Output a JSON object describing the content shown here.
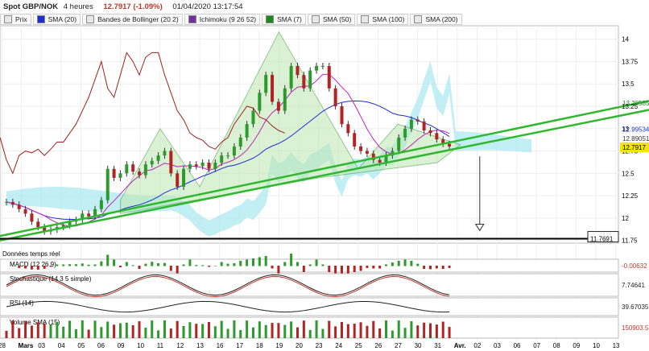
{
  "header": {
    "instrument": "Spot GBP/NOK",
    "timeframe": "4 heures",
    "price_change": "12.7917 (-1.09%)",
    "datetime": "01/04/2020 13:17:54"
  },
  "legend": [
    {
      "label": "Prix",
      "color": "#e8e8e8"
    },
    {
      "label": "SMA (20)",
      "color": "#1a2fd8"
    },
    {
      "label": "Bandes de Bollinger (20 2)",
      "color": "#e8e8e8"
    },
    {
      "label": "Ichimoku (9 26 52)",
      "color": "#7030a0"
    },
    {
      "label": "SMA (7)",
      "color": "#1a8a1a"
    },
    {
      "label": "SMA (50)",
      "color": "#e8e8e8"
    },
    {
      "label": "SMA (100)",
      "color": "#e8e8e8"
    },
    {
      "label": "SMA (200)",
      "color": "#e8e8e8"
    }
  ],
  "panels": {
    "volume_source": "Données temps réel",
    "macd": {
      "label": "MACD (12 26 9)",
      "value": "-0.00632"
    },
    "stoch": {
      "label": "Stochastique (14 3 5 simple)",
      "value": "7.74641"
    },
    "rsi": {
      "label": "RSI (14)",
      "value": "39.67035"
    },
    "volume": {
      "label": "Volume",
      "sma_label": "SMA (15)",
      "value": "150903.53"
    }
  },
  "chart_data": {
    "type": "candlestick",
    "ylim": [
      11.72,
      14.15
    ],
    "y_ticks": [
      "14",
      "13.75",
      "13.5",
      "13.25",
      "13",
      "12.75",
      "12.5",
      "12.25",
      "12",
      "11.75"
    ],
    "x_ticks": [
      "28",
      "Mars",
      "03",
      "04",
      "05",
      "06",
      "09",
      "10",
      "11",
      "12",
      "13",
      "16",
      "17",
      "18",
      "19",
      "20",
      "23",
      "24",
      "25",
      "26",
      "27",
      "30",
      "31",
      "Avr.",
      "02",
      "03",
      "06",
      "07",
      "08",
      "09",
      "10",
      "13"
    ],
    "price_labels": [
      {
        "text": "13.28585",
        "value": 13.286,
        "color": "#1a8a1a"
      },
      {
        "text": "12.99534",
        "value": 12.995,
        "color": "#1a2fd8"
      },
      {
        "text": "12.89051",
        "value": 12.891,
        "color": "#333333"
      },
      {
        "text": "12.7917",
        "value": 12.792,
        "color": "#000000",
        "bg": "#f3e600"
      },
      {
        "text": "11.7691",
        "value": 11.769,
        "color": "#000000"
      }
    ],
    "support_level": 11.7691,
    "trendlines": [
      {
        "name": "upper",
        "from": [
          "28",
          11.8
        ],
        "to": [
          "13",
          13.31
        ]
      },
      {
        "name": "lower",
        "from": [
          "28",
          11.75
        ],
        "to": [
          "13",
          13.21
        ]
      }
    ],
    "target_arrow": {
      "from": 12.69,
      "to": 11.86
    },
    "close": [
      12.18,
      12.15,
      12.1,
      12.05,
      11.96,
      11.9,
      11.85,
      11.87,
      11.9,
      11.92,
      11.96,
      11.98,
      12.05,
      12.02,
      12.1,
      12.2,
      12.55,
      12.45,
      12.5,
      12.6,
      12.52,
      12.48,
      12.6,
      12.64,
      12.7,
      12.75,
      12.5,
      12.35,
      12.55,
      12.6,
      12.58,
      12.62,
      12.55,
      12.62,
      12.7,
      12.7,
      12.8,
      12.9,
      13.05,
      13.2,
      13.4,
      13.6,
      13.3,
      13.2,
      13.45,
      13.7,
      13.6,
      13.45,
      13.65,
      13.7,
      13.7,
      13.45,
      13.25,
      13.05,
      12.95,
      12.8,
      12.75,
      12.72,
      12.65,
      12.62,
      12.7,
      12.75,
      12.9,
      13.0,
      13.1,
      13.08,
      12.98,
      12.95,
      12.88,
      12.83,
      12.8
    ]
  }
}
